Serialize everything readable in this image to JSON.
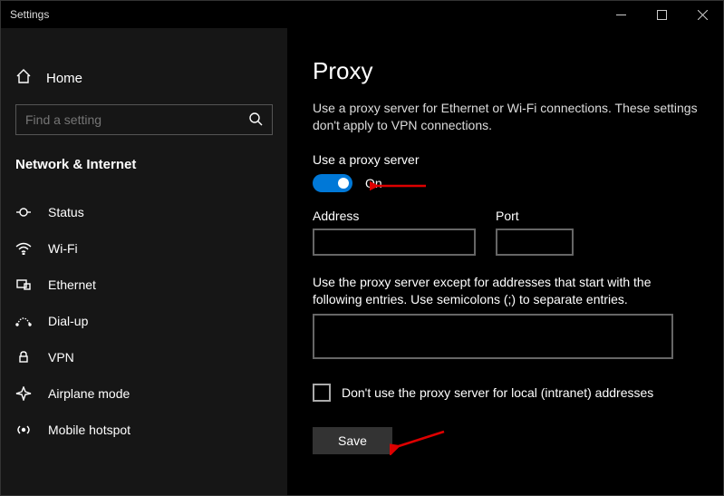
{
  "window_title": "Settings",
  "sidebar": {
    "home_label": "Home",
    "search_placeholder": "Find a setting",
    "category": "Network & Internet",
    "items": [
      {
        "label": "Status"
      },
      {
        "label": "Wi-Fi"
      },
      {
        "label": "Ethernet"
      },
      {
        "label": "Dial-up"
      },
      {
        "label": "VPN"
      },
      {
        "label": "Airplane mode"
      },
      {
        "label": "Mobile hotspot"
      }
    ]
  },
  "main": {
    "title": "Proxy",
    "description": "Use a proxy server for Ethernet or Wi-Fi connections. These settings don't apply to VPN connections.",
    "use_proxy_label": "Use a proxy server",
    "toggle_state": "On",
    "address_label": "Address",
    "address_value": "",
    "port_label": "Port",
    "port_value": "",
    "except_label": "Use the proxy server except for addresses that start with the following entries. Use semicolons (;) to separate entries.",
    "except_value": "",
    "local_checkbox_label": "Don't use the proxy server for local (intranet) addresses",
    "save_label": "Save"
  }
}
